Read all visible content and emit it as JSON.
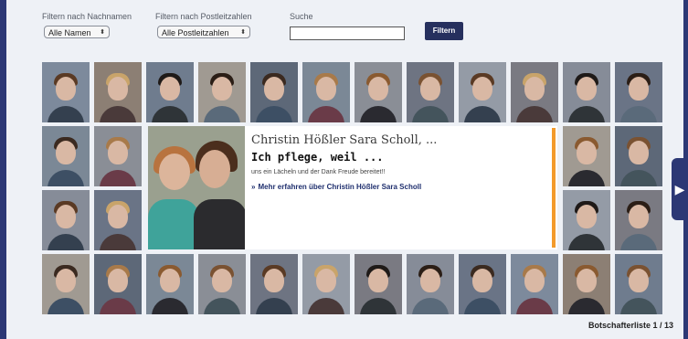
{
  "filters": {
    "lastname_label": "Filtern nach Nachnamen",
    "lastname_value": "Alle Namen",
    "postcode_label": "Filtern nach Postleitzahlen",
    "postcode_value": "Alle Postleitzahlen",
    "search_label": "Suche",
    "search_value": "",
    "submit_label": "Filtern"
  },
  "featured": {
    "name": "Christin Hößler Sara Scholl, ...",
    "quote": "Ich pflege, weil ...",
    "subtitle": "uns ein Lächeln und der Dank Freude bereitet!!",
    "link": "Mehr erfahren über Christin Hößler Sara Scholl"
  },
  "pagination": {
    "label": "Botschafterliste 1 / 13"
  },
  "colors": {
    "accent": "#f39a2b",
    "navy": "#2c3875"
  },
  "icons": {
    "next": "chevron-right-icon"
  }
}
